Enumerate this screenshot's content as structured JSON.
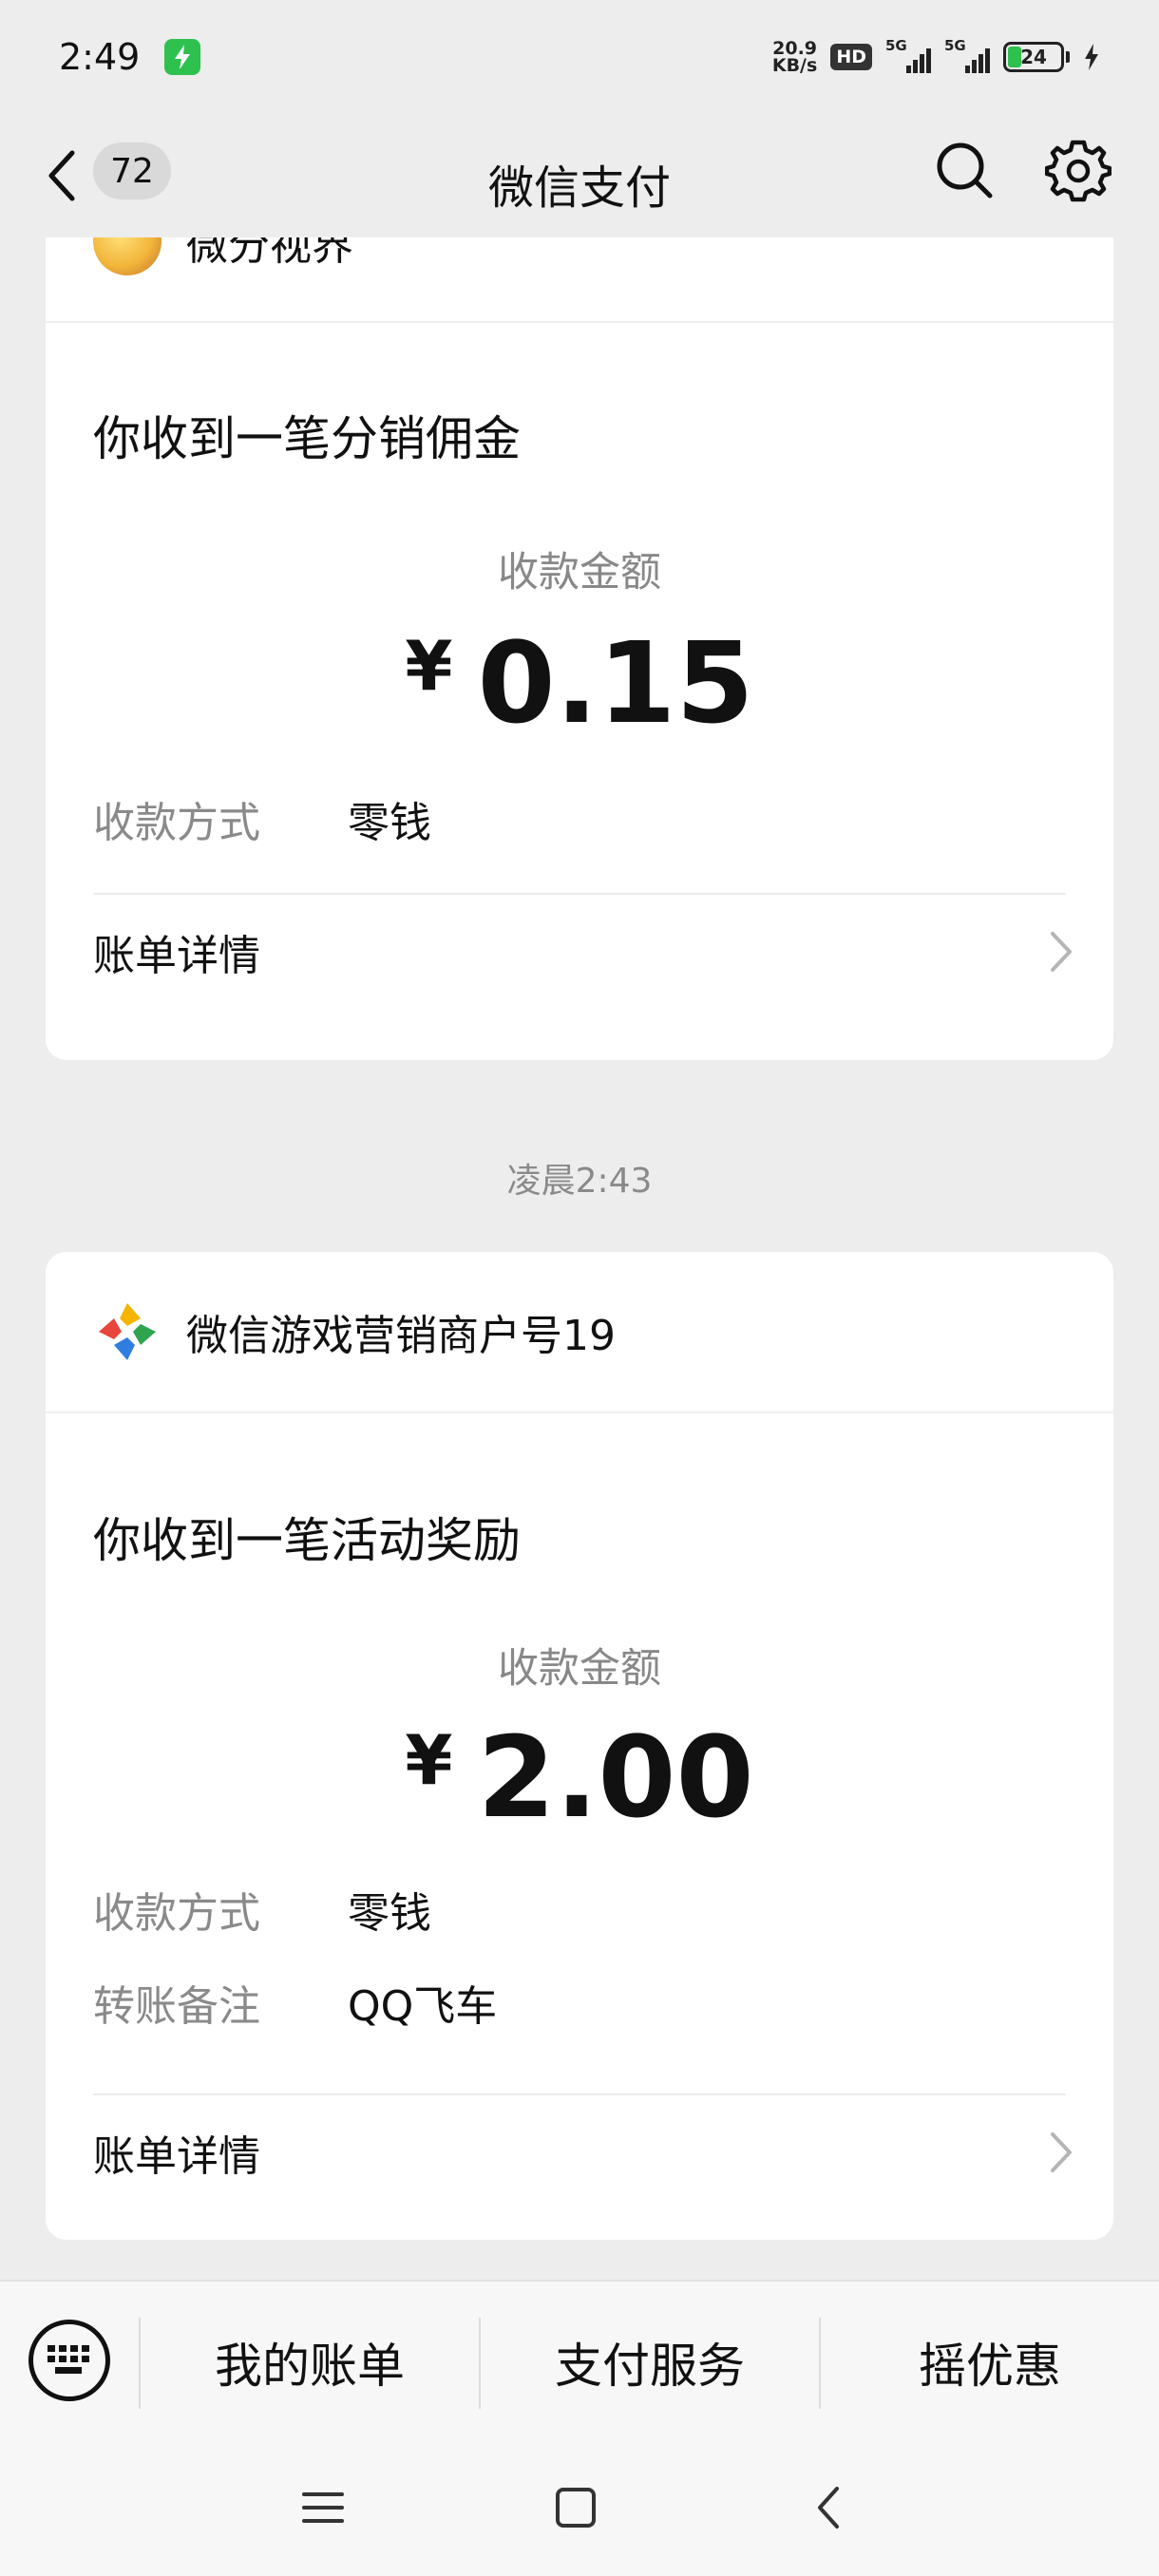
{
  "status_bar": {
    "time": "2:49",
    "net_speed_value": "20.9",
    "net_speed_unit": "KB/s",
    "hd_label": "HD",
    "signal1_label": "5G",
    "signal2_label": "5G",
    "battery_level": "24"
  },
  "header": {
    "unread_count": "72",
    "title": "微信支付"
  },
  "cards": [
    {
      "merchant_name": "微分视界",
      "notice_title": "你收到一笔分销佣金",
      "amount_label": "收款金额",
      "currency": "¥",
      "amount": "0.15",
      "rows": [
        {
          "key": "收款方式",
          "value": "零钱"
        }
      ],
      "detail_label": "账单详情"
    },
    {
      "time_separator": "凌晨2:43",
      "merchant_name": "微信游戏营销商户号19",
      "notice_title": "你收到一笔活动奖励",
      "amount_label": "收款金额",
      "currency": "¥",
      "amount": "2.00",
      "rows": [
        {
          "key": "收款方式",
          "value": "零钱"
        },
        {
          "key": "转账备注",
          "value": "QQ飞车"
        }
      ],
      "detail_label": "账单详情"
    }
  ],
  "bottom_menu": {
    "items": [
      "我的账单",
      "支付服务",
      "摇优惠"
    ]
  },
  "icons": {
    "back": "chevron-left-icon",
    "search": "search-icon",
    "settings": "gear-icon",
    "keyboard": "keyboard-icon",
    "detail": "chevron-right-icon"
  },
  "colors": {
    "background": "#ededed",
    "card": "#ffffff",
    "accent_green": "#2ec14e"
  }
}
